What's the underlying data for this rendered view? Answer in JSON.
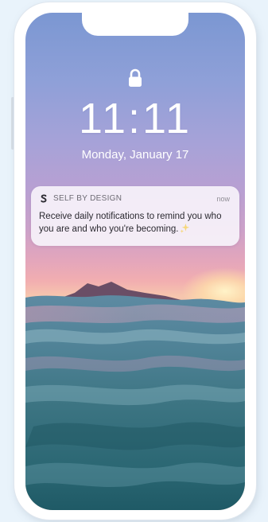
{
  "lockscreen": {
    "time": "11:11",
    "date": "Monday, January 17"
  },
  "notification": {
    "app_name": "SELF BY DESIGN",
    "time": "now",
    "message": "Receive daily notifications to remind you who you are and who you're becoming."
  },
  "icons": {
    "lock": "lock-icon",
    "app": "self-by-design-logo-icon",
    "sparkle": "sparkle-icon"
  },
  "colors": {
    "sky_top": "#7b97d2",
    "sky_horizon": "#f2aeb0",
    "water": "#2f6f7a",
    "notification_bg": "#f6f2fa"
  }
}
